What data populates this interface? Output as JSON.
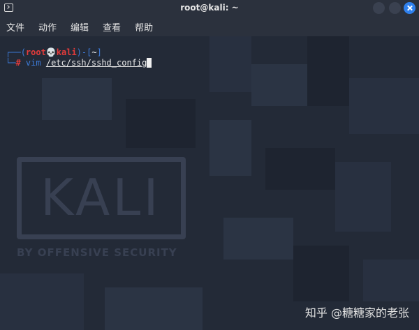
{
  "window": {
    "title": "root@kali: ~",
    "app_icon": "terminal-icon"
  },
  "menu": {
    "items": [
      "文件",
      "动作",
      "编辑",
      "查看",
      "帮助"
    ]
  },
  "prompt": {
    "open_paren": "(",
    "user": "root",
    "skull": "💀",
    "host": "kali",
    "sep": ")-[",
    "dir": "~",
    "close_bracket": "]",
    "hash": "#",
    "command": "vim",
    "argument": "/etc/ssh/sshd_config"
  },
  "background": {
    "logo_text": "KALI",
    "logo_sub": "BY OFFENSIVE SECURITY"
  },
  "watermark": "知乎 @糖糖家的老张",
  "colors": {
    "accent": "#2f80ed",
    "prompt_blue": "#3d7bd9",
    "prompt_red": "#e33b3b",
    "terminal_bg": "#232a37"
  }
}
